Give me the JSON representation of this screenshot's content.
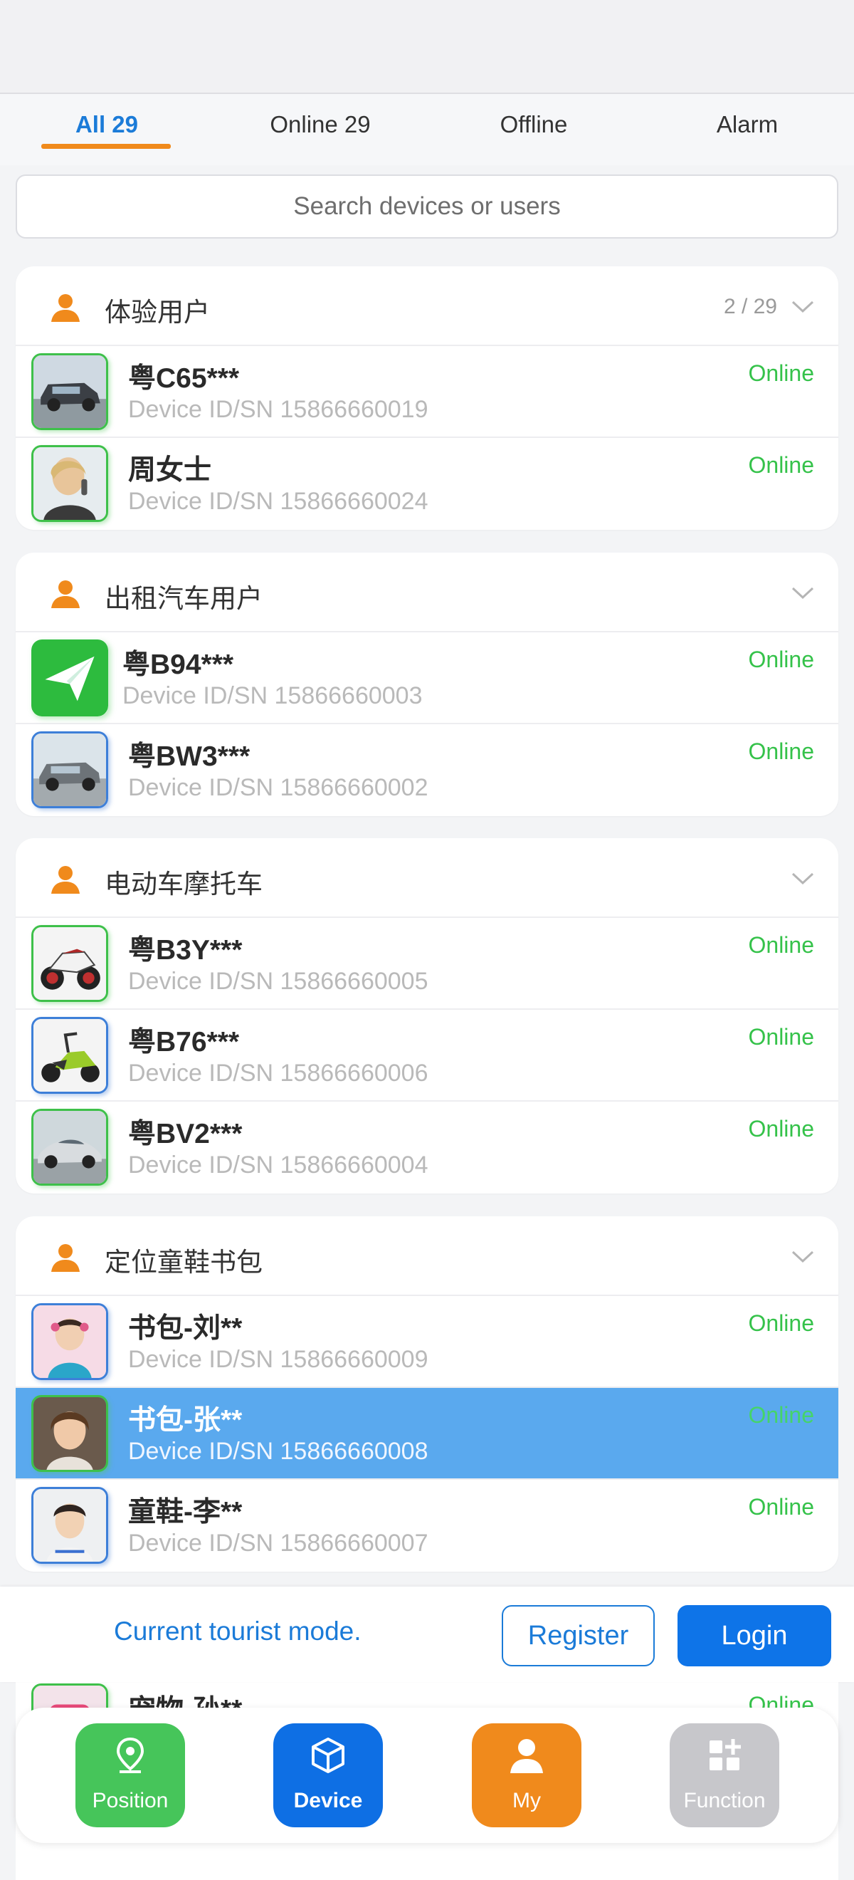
{
  "tabs": [
    {
      "label": "All 29"
    },
    {
      "label": "Online 29"
    },
    {
      "label": "Offline"
    },
    {
      "label": "Alarm"
    }
  ],
  "search": {
    "placeholder": "Search devices or users"
  },
  "groups": [
    {
      "title": "体验用户",
      "count": "2 / 29",
      "devices": [
        {
          "name": "粤C65***",
          "id": "Device ID/SN 15866660019",
          "status": "Online",
          "avatar": "suv-icon"
        },
        {
          "name": "周女士",
          "id": "Device ID/SN 15866660024",
          "status": "Online",
          "avatar": "woman-portrait-icon"
        }
      ]
    },
    {
      "title": "出租汽车用户",
      "count": "",
      "devices": [
        {
          "name": "粤B94***",
          "id": "Device ID/SN 15866660003",
          "status": "Online",
          "avatar": "paper-plane-icon"
        },
        {
          "name": "粤BW3***",
          "id": "Device ID/SN 15866660002",
          "status": "Online",
          "avatar": "suv-icon"
        }
      ]
    },
    {
      "title": "电动车摩托车",
      "count": "",
      "devices": [
        {
          "name": "粤B3Y***",
          "id": "Device ID/SN 15866660005",
          "status": "Online",
          "avatar": "motorcycle-icon"
        },
        {
          "name": "粤B76***",
          "id": "Device ID/SN 15866660006",
          "status": "Online",
          "avatar": "scooter-icon"
        },
        {
          "name": "粤BV2***",
          "id": "Device ID/SN 15866660004",
          "status": "Online",
          "avatar": "sports-car-icon"
        }
      ]
    },
    {
      "title": "定位童鞋书包",
      "count": "",
      "devices": [
        {
          "name": "书包-刘**",
          "id": "Device ID/SN 15866660009",
          "status": "Online",
          "avatar": "girl-portrait-icon"
        },
        {
          "name": "书包-张**",
          "id": "Device ID/SN 15866660008",
          "status": "Online",
          "avatar": "girl-portrait-icon"
        },
        {
          "name": "童鞋-李**",
          "id": "Device ID/SN 15866660007",
          "status": "Online",
          "avatar": "boy-portrait-icon"
        }
      ]
    }
  ],
  "peek": {
    "name": "宠物-孙**",
    "status": "Online"
  },
  "tourist_bar": {
    "text": "Current tourist mode.",
    "register": "Register",
    "login": "Login"
  },
  "bottom_nav": [
    {
      "label": "Position",
      "icon": "location-pin-icon"
    },
    {
      "label": "Device",
      "icon": "cube-icon"
    },
    {
      "label": "My",
      "icon": "person-icon"
    },
    {
      "label": "Function",
      "icon": "grid-plus-icon"
    }
  ],
  "colors": {
    "accent": "#1b7bd8",
    "tab_underline": "#f08a1c",
    "online": "#35c24a",
    "selected_row": "#5aa9ee"
  }
}
